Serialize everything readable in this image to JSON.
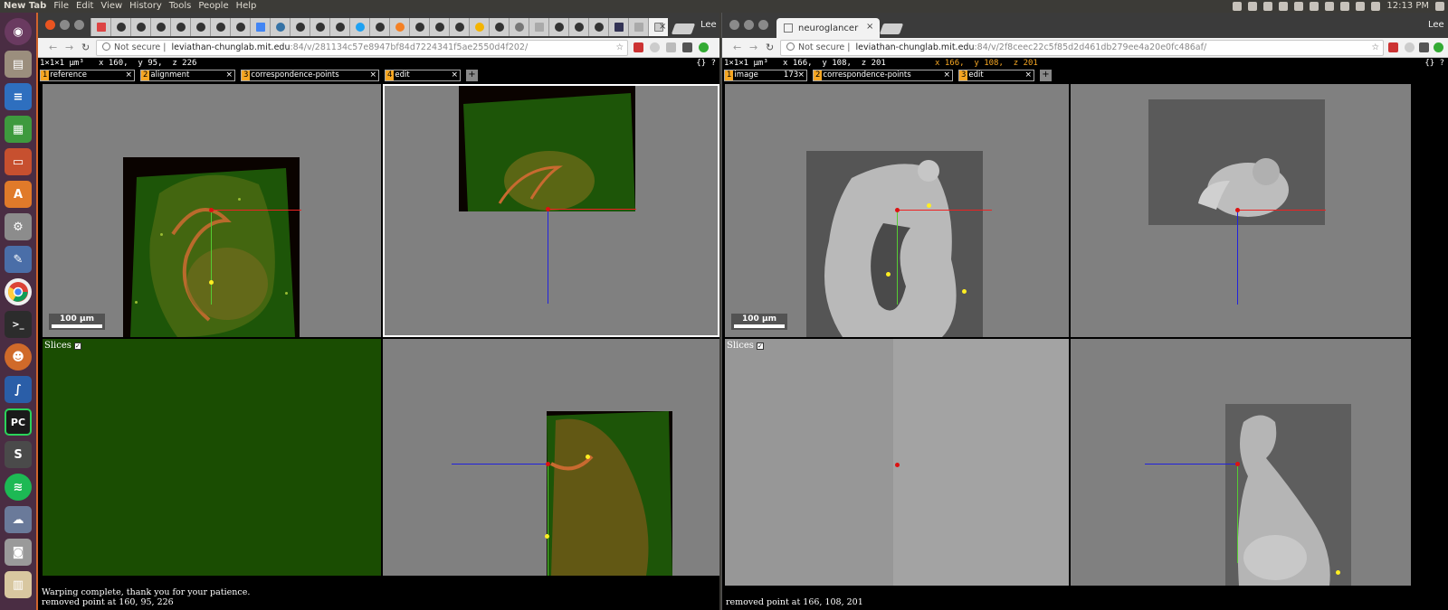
{
  "topbar": {
    "app_title": "New Tab",
    "menus": [
      "File",
      "Edit",
      "View",
      "History",
      "Tools",
      "People",
      "Help"
    ],
    "clock": "12:13 PM"
  },
  "launcher": {
    "items": [
      "ubuntu-dash-icon",
      "files-icon",
      "writer-icon",
      "calc-icon",
      "impress-icon",
      "software-center-icon",
      "settings-icon",
      "text-editor-icon",
      "chrome-icon",
      "terminal-icon",
      "unknown-app-icon",
      "fiji-icon",
      "pycharm-icon",
      "sublime-icon",
      "spotify-icon",
      "vm-icon",
      "screenshot-icon",
      "trash-icon"
    ],
    "pycharm_label": "PC",
    "sublime_label": "S",
    "terminal_label": ">_"
  },
  "left_window": {
    "user": "Lee",
    "tab_close": "×",
    "url_security": "Not secure",
    "url_host": "leviathan-chunglab.mit.edu",
    "url_path": ":84/v/281134c57e8947bf84d7224341f5ae2550d4f202/",
    "status_line": "1×1×1 µm³",
    "coords": "x 160,  y 95,  z 226",
    "corner": "{} ?",
    "layers": [
      {
        "num": "1",
        "name": "reference",
        "value": ""
      },
      {
        "num": "2",
        "name": "alignment",
        "value": ""
      },
      {
        "num": "3",
        "name": "correspondence-points",
        "value": ""
      },
      {
        "num": "4",
        "name": "edit",
        "value": ""
      }
    ],
    "add_layer": "+",
    "scale_bar": "100 µm",
    "slices_label": "Slices",
    "messages": [
      "Warping complete, thank you for your patience.",
      "removed point at 160, 95, 226"
    ]
  },
  "right_window": {
    "user": "Lee",
    "tab_title": "neuroglancer",
    "tab_close": "×",
    "url_security": "Not secure",
    "url_host": "leviathan-chunglab.mit.edu",
    "url_path": ":84/v/2f8ceec22c5f85d2d461db279ee4a20e0fc486af/",
    "status_line": "1×1×1 µm³",
    "coords": "x 166,  y 108,  z 201",
    "mouse_coords": "x 166,  y 108,  z 201",
    "corner": "{} ?",
    "layers": [
      {
        "num": "1",
        "name": "image",
        "value": "173"
      },
      {
        "num": "2",
        "name": "correspondence-points",
        "value": ""
      },
      {
        "num": "3",
        "name": "edit",
        "value": ""
      }
    ],
    "add_layer": "+",
    "scale_bar": "100 µm",
    "slices_label": "Slices",
    "messages": [
      "removed point at 166, 108, 201"
    ]
  },
  "colors": {
    "accent": "#e95420",
    "layer_num": "#f5a623",
    "panel_gray": "#808080",
    "tissue_green": "#1f5e0a",
    "point_yellow": "#ffee22",
    "point_red": "#dd1111"
  }
}
